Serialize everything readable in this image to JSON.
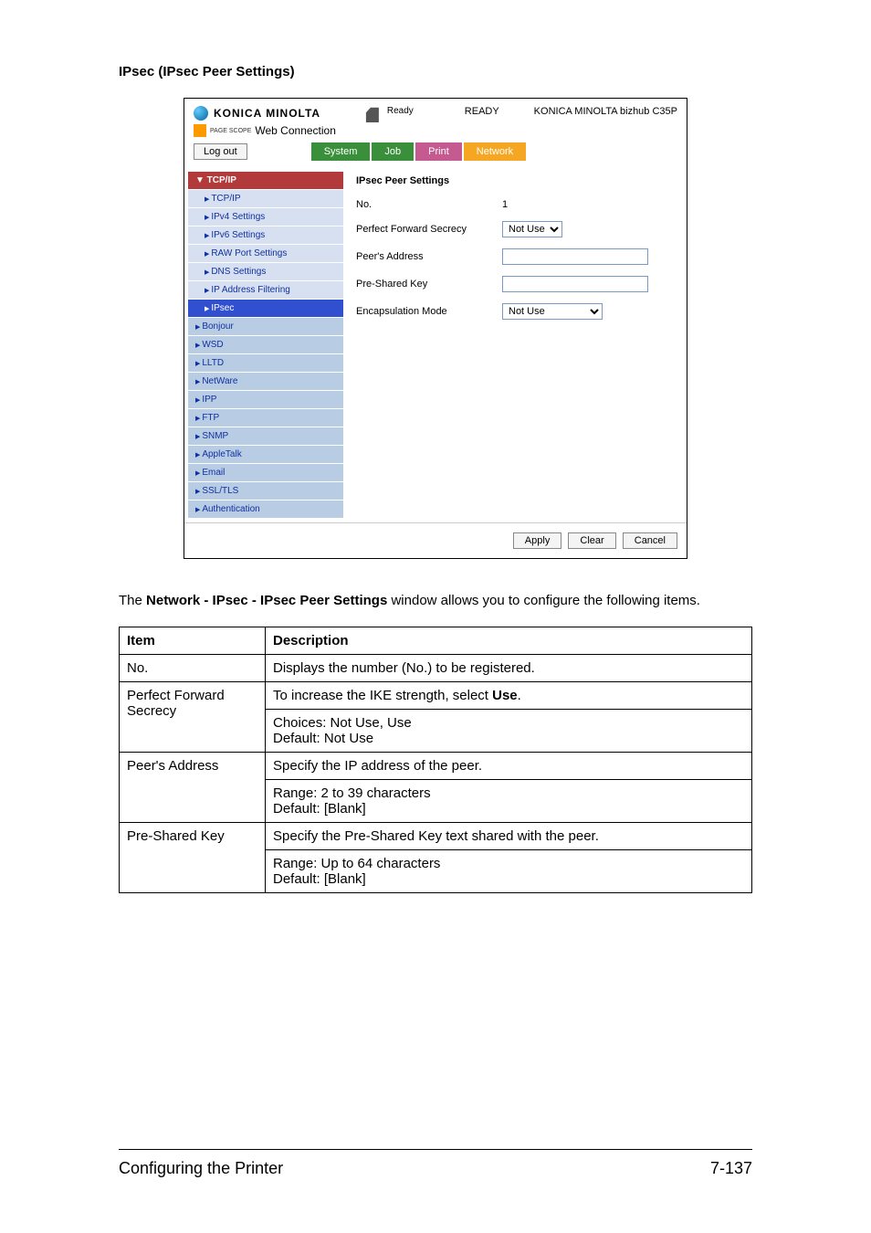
{
  "section_title": "IPsec (IPsec Peer Settings)",
  "screenshot": {
    "brand": "KONICA MINOLTA",
    "pagescope_small": "PAGE\nSCOPE",
    "pagescope": "Web Connection",
    "status_small": "Ready",
    "status_big": "READY",
    "model": "KONICA MINOLTA bizhub C35P",
    "logout": "Log out",
    "tabs": {
      "system": "System",
      "job": "Job",
      "print": "Print",
      "network": "Network"
    },
    "sidebar": {
      "head": "▼ TCP/IP",
      "subs": [
        "TCP/IP",
        "IPv4 Settings",
        "IPv6 Settings",
        "RAW Port Settings",
        "DNS Settings",
        "IP Address Filtering"
      ],
      "active": "IPsec",
      "items": [
        "Bonjour",
        "WSD",
        "LLTD",
        "NetWare",
        "IPP",
        "FTP",
        "SNMP",
        "AppleTalk",
        "Email",
        "SSL/TLS",
        "Authentication"
      ]
    },
    "content": {
      "title": "IPsec Peer Settings",
      "rows": {
        "no_label": "No.",
        "no_value": "1",
        "pfs_label": "Perfect Forward Secrecy",
        "peer_label": "Peer's Address",
        "psk_label": "Pre-Shared Key",
        "encap_label": "Encapsulation Mode"
      },
      "pfs_opt": "Not Use",
      "encap_opt": "Not Use",
      "buttons": {
        "apply": "Apply",
        "clear": "Clear",
        "cancel": "Cancel"
      }
    }
  },
  "paragraph_prefix": "The ",
  "paragraph_bold": "Network - IPsec - IPsec Peer Settings",
  "paragraph_suffix": " window allows you to configure the following items.",
  "table": {
    "head_item": "Item",
    "head_desc": "Description",
    "r1c1": "No.",
    "r1c2": "Displays the number (No.) to be registered.",
    "r2c1": "Perfect Forward Secrecy",
    "r2c2a_pre": "To increase the IKE strength, select ",
    "r2c2a_bold": "Use",
    "r2c2a_post": ".",
    "r2c2b": "Choices: Not Use, Use",
    "r2c2c": "Default:  Not Use",
    "r3c1": "Peer's Address",
    "r3c2a": "Specify the IP address of the peer.",
    "r3c2b": "Range:   2 to 39 characters",
    "r3c2c": "Default:  [Blank]",
    "r4c1": "Pre-Shared Key",
    "r4c2a": "Specify the Pre-Shared Key text shared with the peer.",
    "r4c2b": "Range:   Up to 64 characters",
    "r4c2c": "Default:  [Blank]"
  },
  "footer": {
    "left": "Configuring the Printer",
    "right": "7-137"
  }
}
